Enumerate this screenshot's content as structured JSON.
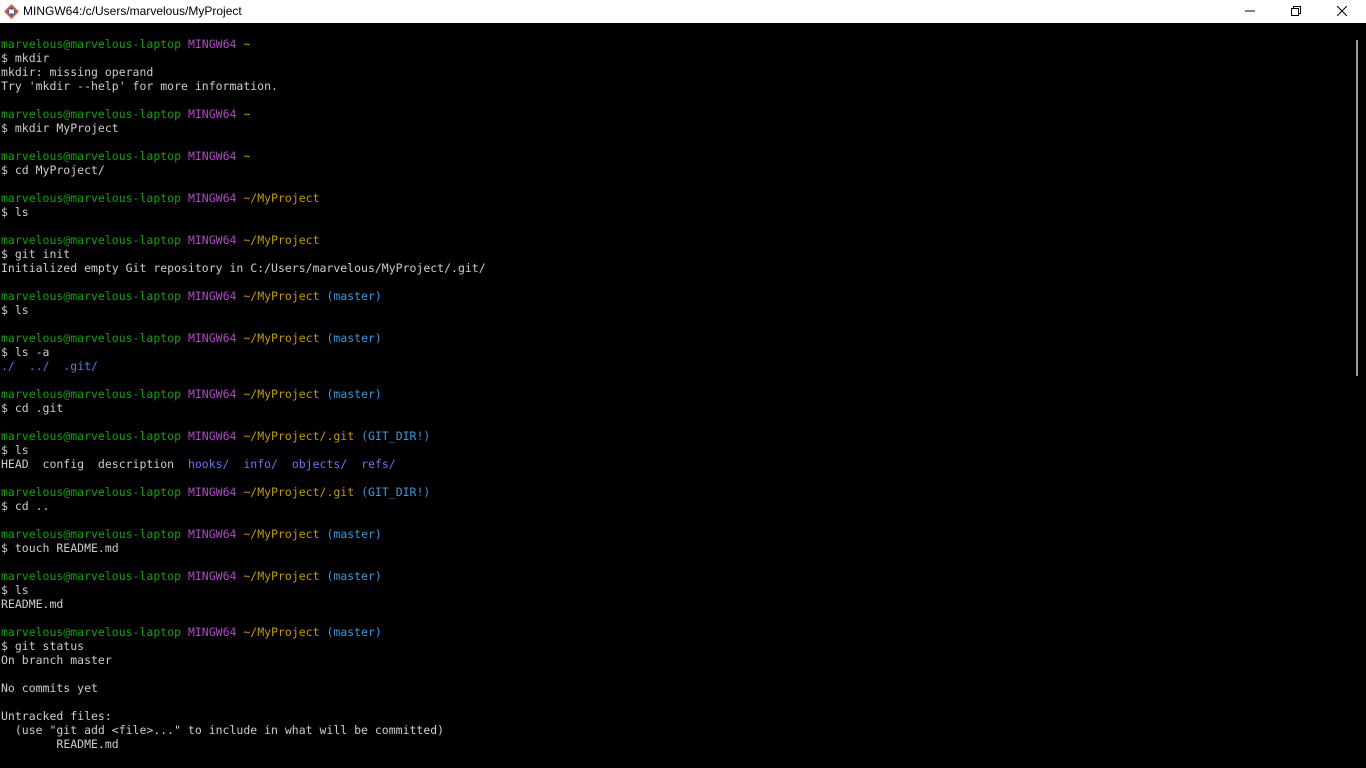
{
  "window": {
    "title": "MINGW64:/c/Users/marvelous/MyProject",
    "icons": {
      "app": "git-bash-icon",
      "minimize": "minimize-icon",
      "maximize": "restore-icon",
      "close": "close-icon"
    }
  },
  "colors": {
    "user": "#13a10e",
    "host": "#b148c6",
    "path": "#c19c00",
    "branch": "#3a96dd",
    "directory": "#4e7dff",
    "untracked": "#e74856",
    "text": "#cccccc"
  },
  "terminal": {
    "lines": [
      {
        "spans": [
          {
            "t": "marvelous@marvelous-laptop",
            "c": "user"
          },
          {
            "t": " "
          },
          {
            "t": "MINGW64",
            "c": "host"
          },
          {
            "t": " "
          },
          {
            "t": "~",
            "c": "path"
          }
        ]
      },
      {
        "spans": [
          {
            "t": "$ mkdir"
          }
        ]
      },
      {
        "spans": [
          {
            "t": "mkdir: missing operand"
          }
        ]
      },
      {
        "spans": [
          {
            "t": "Try 'mkdir --help' for more information."
          }
        ]
      },
      {
        "spans": []
      },
      {
        "spans": [
          {
            "t": "marvelous@marvelous-laptop",
            "c": "user"
          },
          {
            "t": " "
          },
          {
            "t": "MINGW64",
            "c": "host"
          },
          {
            "t": " "
          },
          {
            "t": "~",
            "c": "path"
          }
        ]
      },
      {
        "spans": [
          {
            "t": "$ mkdir MyProject"
          }
        ]
      },
      {
        "spans": []
      },
      {
        "spans": [
          {
            "t": "marvelous@marvelous-laptop",
            "c": "user"
          },
          {
            "t": " "
          },
          {
            "t": "MINGW64",
            "c": "host"
          },
          {
            "t": " "
          },
          {
            "t": "~",
            "c": "path"
          }
        ]
      },
      {
        "spans": [
          {
            "t": "$ cd MyProject/"
          }
        ]
      },
      {
        "spans": []
      },
      {
        "spans": [
          {
            "t": "marvelous@marvelous-laptop",
            "c": "user"
          },
          {
            "t": " "
          },
          {
            "t": "MINGW64",
            "c": "host"
          },
          {
            "t": " "
          },
          {
            "t": "~/MyProject",
            "c": "path"
          }
        ]
      },
      {
        "spans": [
          {
            "t": "$ ls"
          }
        ]
      },
      {
        "spans": []
      },
      {
        "spans": [
          {
            "t": "marvelous@marvelous-laptop",
            "c": "user"
          },
          {
            "t": " "
          },
          {
            "t": "MINGW64",
            "c": "host"
          },
          {
            "t": " "
          },
          {
            "t": "~/MyProject",
            "c": "path"
          }
        ]
      },
      {
        "spans": [
          {
            "t": "$ git init"
          }
        ]
      },
      {
        "spans": [
          {
            "t": "Initialized empty Git repository in C:/Users/marvelous/MyProject/.git/"
          }
        ]
      },
      {
        "spans": []
      },
      {
        "spans": [
          {
            "t": "marvelous@marvelous-laptop",
            "c": "user"
          },
          {
            "t": " "
          },
          {
            "t": "MINGW64",
            "c": "host"
          },
          {
            "t": " "
          },
          {
            "t": "~/MyProject",
            "c": "path"
          },
          {
            "t": " "
          },
          {
            "t": "(master)",
            "c": "branch"
          }
        ]
      },
      {
        "spans": [
          {
            "t": "$ ls"
          }
        ]
      },
      {
        "spans": []
      },
      {
        "spans": [
          {
            "t": "marvelous@marvelous-laptop",
            "c": "user"
          },
          {
            "t": " "
          },
          {
            "t": "MINGW64",
            "c": "host"
          },
          {
            "t": " "
          },
          {
            "t": "~/MyProject",
            "c": "path"
          },
          {
            "t": " "
          },
          {
            "t": "(master)",
            "c": "branch"
          }
        ]
      },
      {
        "spans": [
          {
            "t": "$ ls -a"
          }
        ]
      },
      {
        "spans": [
          {
            "t": "./",
            "c": "dir"
          },
          {
            "t": "  "
          },
          {
            "t": "../",
            "c": "dir"
          },
          {
            "t": "  "
          },
          {
            "t": ".git/",
            "c": "dir"
          }
        ]
      },
      {
        "spans": []
      },
      {
        "spans": [
          {
            "t": "marvelous@marvelous-laptop",
            "c": "user"
          },
          {
            "t": " "
          },
          {
            "t": "MINGW64",
            "c": "host"
          },
          {
            "t": " "
          },
          {
            "t": "~/MyProject",
            "c": "path"
          },
          {
            "t": " "
          },
          {
            "t": "(master)",
            "c": "branch"
          }
        ]
      },
      {
        "spans": [
          {
            "t": "$ cd .git"
          }
        ]
      },
      {
        "spans": []
      },
      {
        "spans": [
          {
            "t": "marvelous@marvelous-laptop",
            "c": "user"
          },
          {
            "t": " "
          },
          {
            "t": "MINGW64",
            "c": "host"
          },
          {
            "t": " "
          },
          {
            "t": "~/MyProject/.git",
            "c": "path"
          },
          {
            "t": " "
          },
          {
            "t": "(GIT_DIR!)",
            "c": "branch"
          }
        ]
      },
      {
        "spans": [
          {
            "t": "$ ls"
          }
        ]
      },
      {
        "spans": [
          {
            "t": "HEAD  config  description  "
          },
          {
            "t": "hooks/",
            "c": "dir2"
          },
          {
            "t": "  "
          },
          {
            "t": "info/",
            "c": "dir2"
          },
          {
            "t": "  "
          },
          {
            "t": "objects/",
            "c": "dir2"
          },
          {
            "t": "  "
          },
          {
            "t": "refs/",
            "c": "dir2"
          }
        ]
      },
      {
        "spans": []
      },
      {
        "spans": [
          {
            "t": "marvelous@marvelous-laptop",
            "c": "user"
          },
          {
            "t": " "
          },
          {
            "t": "MINGW64",
            "c": "host"
          },
          {
            "t": " "
          },
          {
            "t": "~/MyProject/.git",
            "c": "path"
          },
          {
            "t": " "
          },
          {
            "t": "(GIT_DIR!)",
            "c": "branch"
          }
        ]
      },
      {
        "spans": [
          {
            "t": "$ cd .."
          }
        ]
      },
      {
        "spans": []
      },
      {
        "spans": [
          {
            "t": "marvelous@marvelous-laptop",
            "c": "user"
          },
          {
            "t": " "
          },
          {
            "t": "MINGW64",
            "c": "host"
          },
          {
            "t": " "
          },
          {
            "t": "~/MyProject",
            "c": "path"
          },
          {
            "t": " "
          },
          {
            "t": "(master)",
            "c": "branch"
          }
        ]
      },
      {
        "spans": [
          {
            "t": "$ touch README.md"
          }
        ]
      },
      {
        "spans": []
      },
      {
        "spans": [
          {
            "t": "marvelous@marvelous-laptop",
            "c": "user"
          },
          {
            "t": " "
          },
          {
            "t": "MINGW64",
            "c": "host"
          },
          {
            "t": " "
          },
          {
            "t": "~/MyProject",
            "c": "path"
          },
          {
            "t": " "
          },
          {
            "t": "(master)",
            "c": "branch"
          }
        ]
      },
      {
        "spans": [
          {
            "t": "$ ls"
          }
        ]
      },
      {
        "spans": [
          {
            "t": "README.md"
          }
        ]
      },
      {
        "spans": []
      },
      {
        "spans": [
          {
            "t": "marvelous@marvelous-laptop",
            "c": "user"
          },
          {
            "t": " "
          },
          {
            "t": "MINGW64",
            "c": "host"
          },
          {
            "t": " "
          },
          {
            "t": "~/MyProject",
            "c": "path"
          },
          {
            "t": " "
          },
          {
            "t": "(master)",
            "c": "branch"
          }
        ]
      },
      {
        "spans": [
          {
            "t": "$ git status"
          }
        ]
      },
      {
        "spans": [
          {
            "t": "On branch master"
          }
        ]
      },
      {
        "spans": []
      },
      {
        "spans": [
          {
            "t": "No commits yet"
          }
        ]
      },
      {
        "spans": []
      },
      {
        "spans": [
          {
            "t": "Untracked files:"
          }
        ]
      },
      {
        "spans": [
          {
            "t": "  (use \"git add <file>...\" to include in what will be committed)"
          }
        ]
      },
      {
        "spans": [
          {
            "t": "        "
          },
          {
            "t": "README.md",
            "c": "untracked"
          }
        ]
      }
    ]
  }
}
